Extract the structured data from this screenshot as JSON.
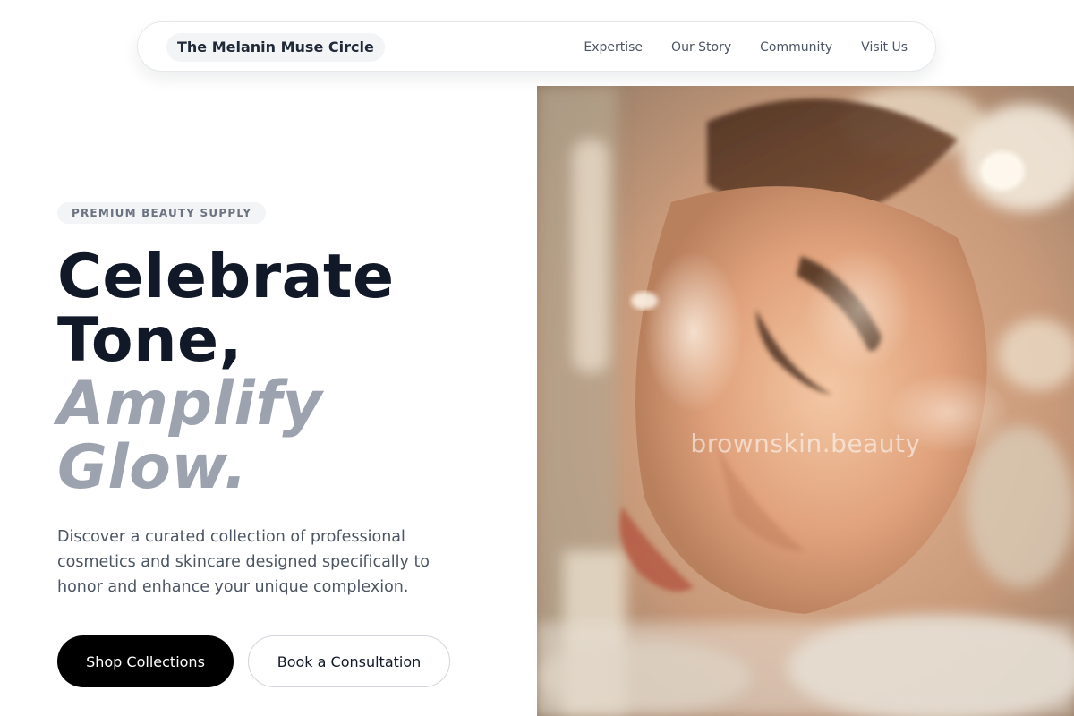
{
  "nav": {
    "brand": "The Melanin Muse Circle",
    "links": [
      "Expertise",
      "Our Story",
      "Community",
      "Visit Us"
    ]
  },
  "hero": {
    "badge": "PREMIUM BEAUTY SUPPLY",
    "headline": {
      "line1": "Celebrate",
      "line2": "Tone,",
      "line3": "Amplify",
      "line4": "Glow."
    },
    "description": "Discover a curated collection of professional cosmetics and skincare designed specifically to honor and enhance your unique complexion.",
    "primary_cta": "Shop Collections",
    "secondary_cta": "Book a Consultation",
    "image_watermark": "brownskin.beauty"
  },
  "colors": {
    "text_dark": "#111827",
    "text_muted": "#9ca3af",
    "body_text": "#4b5563",
    "primary_button": "#000000",
    "badge_bg": "#f3f4f6"
  }
}
